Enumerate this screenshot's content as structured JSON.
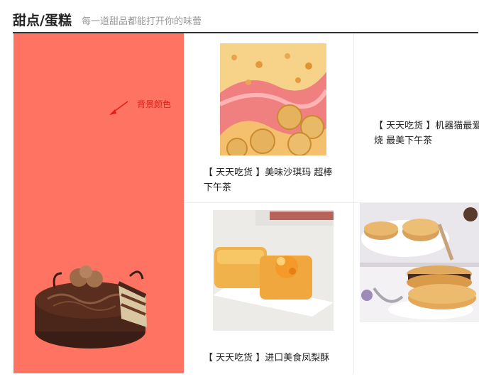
{
  "header": {
    "title": "甜点/蛋糕",
    "subtitle": "每一道甜品都能打开你的味蕾"
  },
  "promo": {
    "note": "背景颜色",
    "bg_color": "#ff7362"
  },
  "products": [
    {
      "name": "【 天天吃货 】美味沙琪玛 超棒下午茶"
    },
    {
      "name": "【 天天吃货 】机器猫最爱 铜锣烧 最美下午茶"
    },
    {
      "name": "【 天天吃货 】进口美食凤梨酥"
    },
    {
      "name": ""
    }
  ]
}
